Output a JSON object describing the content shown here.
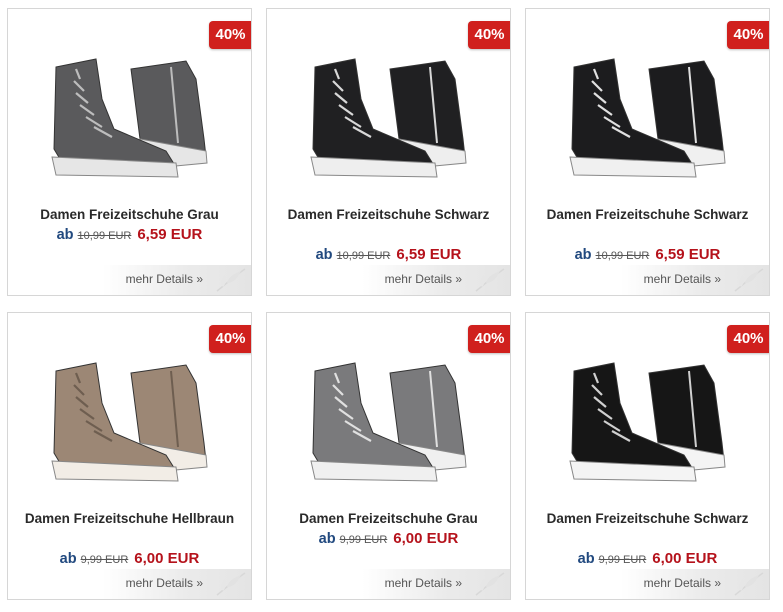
{
  "products": [
    {
      "title": "Damen Freizeitschuhe Grau",
      "ab": "ab",
      "old_price": "10,99 EUR",
      "new_price": "6,59 EUR",
      "discount": "40%",
      "details": "mehr Details »",
      "shoe_color": "#5a5a5c",
      "lace_color": "#bdbdbd",
      "sole_color": "#e6e6e6"
    },
    {
      "title": "Damen Freizeitschuhe Schwarz",
      "ab": "ab",
      "old_price": "10,99 EUR",
      "new_price": "6,59 EUR",
      "discount": "40%",
      "details": "mehr Details »",
      "shoe_color": "#202022",
      "lace_color": "#d8d8d8",
      "sole_color": "#eeeeee"
    },
    {
      "title": "Damen Freizeitschuhe Schwarz",
      "ab": "ab",
      "old_price": "10,99 EUR",
      "new_price": "6,59 EUR",
      "discount": "40%",
      "details": "mehr Details »",
      "shoe_color": "#1c1c1e",
      "lace_color": "#e0e0e0",
      "sole_color": "#f0f0f0"
    },
    {
      "title": "Damen Freizeitschuhe Hellbraun",
      "ab": "ab",
      "old_price": "9,99 EUR",
      "new_price": "6,00 EUR",
      "discount": "40%",
      "details": "mehr Details »",
      "shoe_color": "#9c8775",
      "lace_color": "#6e5e50",
      "sole_color": "#f2ede6"
    },
    {
      "title": "Damen Freizeitschuhe Grau",
      "ab": "ab",
      "old_price": "9,99 EUR",
      "new_price": "6,00 EUR",
      "discount": "40%",
      "details": "mehr Details »",
      "shoe_color": "#7a7a7c",
      "lace_color": "#e0e0e0",
      "sole_color": "#f0f0f0"
    },
    {
      "title": "Damen Freizeitschuhe Schwarz",
      "ab": "ab",
      "old_price": "9,99 EUR",
      "new_price": "6,00 EUR",
      "discount": "40%",
      "details": "mehr Details »",
      "shoe_color": "#161616",
      "lace_color": "#d0d0d0",
      "sole_color": "#f4f4f4"
    }
  ],
  "colors": {
    "badge": "#d0201d",
    "new_price": "#b5121b",
    "ab": "#21497f"
  }
}
